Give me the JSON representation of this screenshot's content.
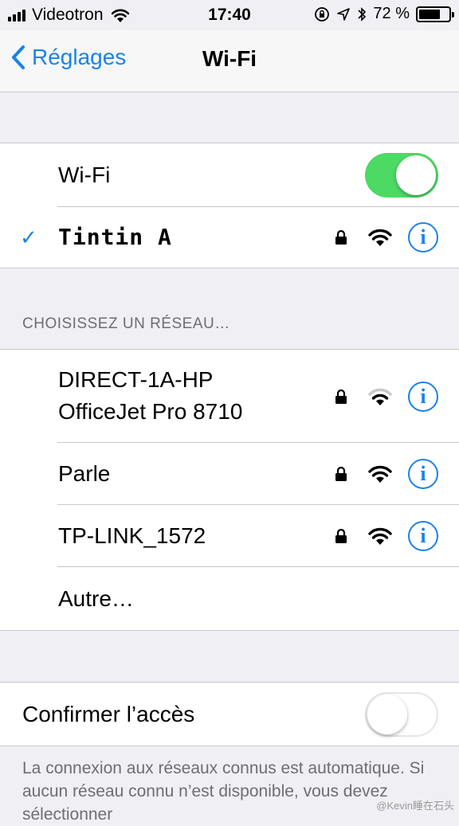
{
  "status_bar": {
    "carrier": "Videotron",
    "time": "17:40",
    "battery_percent": "72 %",
    "battery_level": 0.72
  },
  "nav": {
    "back_label": "Réglages",
    "title": "Wi-Fi"
  },
  "wifi_toggle": {
    "label": "Wi-Fi",
    "state": "on"
  },
  "connected_network": {
    "name": "Tintin A",
    "secured": true,
    "signal": 3
  },
  "section_header": "CHOISISSEZ UN RÉSEAU…",
  "networks": [
    {
      "name_line1": "DIRECT-1A-HP",
      "name_line2": "OfficeJet Pro 8710",
      "secured": true,
      "signal": 2
    },
    {
      "name": "Parle",
      "secured": true,
      "signal": 3
    },
    {
      "name": "TP-LINK_1572",
      "secured": true,
      "signal": 3
    }
  ],
  "other": {
    "label": "Autre…"
  },
  "ask_to_join": {
    "label": "Confirmer l’accès",
    "state": "off"
  },
  "footer_text": "La connexion aux réseaux connus est automatique. Si aucun réseau connu n’est disponible, vous devez sélectionner",
  "watermark": "@Kevin睡在石头",
  "icons": {
    "back": "chevron-left-icon",
    "lock": "lock-icon",
    "wifi": "wifi-icon",
    "info": "info-icon",
    "check": "checkmark-icon"
  },
  "colors": {
    "accent": "#1a82ea",
    "toggle_on": "#4cd964"
  }
}
